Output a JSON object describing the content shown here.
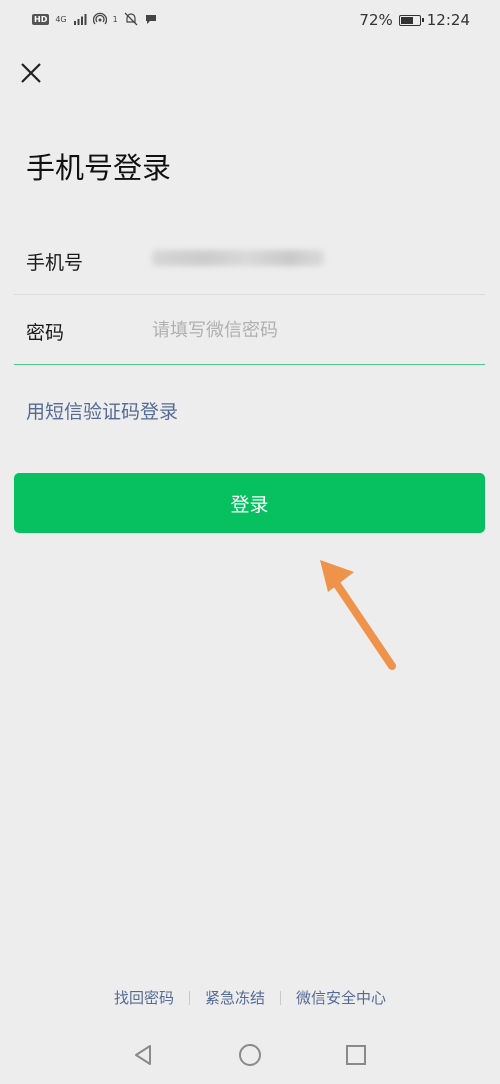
{
  "status_bar": {
    "hd": "HD",
    "signal_type": "4G",
    "notification_count": "1",
    "battery_percent": "72%",
    "battery_level": 0.72,
    "time": "12:24"
  },
  "header": {
    "close_icon": "close-icon",
    "title": "手机号登录"
  },
  "form": {
    "phone_label": "手机号",
    "phone_value_state": "blurred",
    "password_label": "密码",
    "password_placeholder": "请填写微信密码",
    "password_value": ""
  },
  "sms_login_link": "用短信验证码登录",
  "login_button": "登录",
  "annotation": {
    "arrow_icon": "arrow-up-left-icon",
    "color": "#f0934a"
  },
  "footer": {
    "links": [
      "找回密码",
      "紧急冻结",
      "微信安全中心"
    ]
  },
  "nav_bar": {
    "back_icon": "triangle-back-icon",
    "home_icon": "circle-home-icon",
    "recent_icon": "square-recent-icon"
  },
  "colors": {
    "accent": "#07c160",
    "link": "#566b94",
    "background": "#ededed",
    "focus_line": "#4ec88a"
  }
}
